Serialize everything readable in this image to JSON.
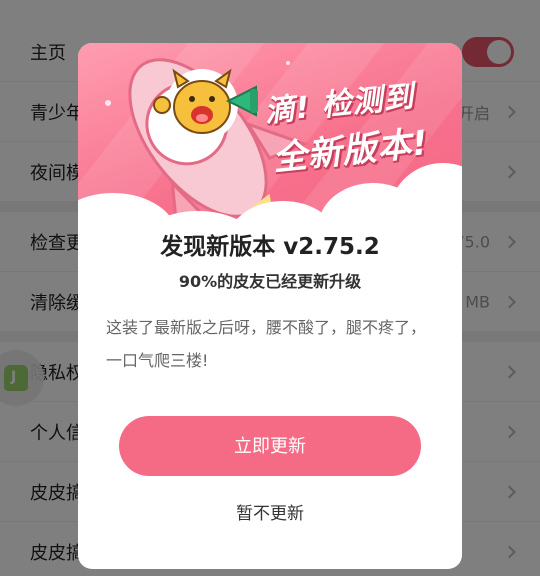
{
  "settings": {
    "rows": [
      {
        "label": "主页"
      },
      {
        "label": "青少年",
        "value": "开启"
      },
      {
        "label": "夜间模"
      },
      {
        "label": "检查更",
        "value": "75.0"
      },
      {
        "label": "清除缓",
        "value": "MB"
      },
      {
        "label": "隐私权"
      },
      {
        "label": "个人信"
      },
      {
        "label": "皮皮搞"
      },
      {
        "label": "皮皮搞"
      }
    ]
  },
  "dialog": {
    "headline_line1": "滴! 检测到",
    "headline_line2": "全新版本!",
    "title": "发现新版本 v2.75.2",
    "subtitle": "90%的皮友已经更新升级",
    "description": "这装了最新版之后呀，腰不酸了，腿不疼了，一口气爬三楼!",
    "update_now": "立即更新",
    "not_now": "暂不更新"
  },
  "colors": {
    "accent": "#f56a85",
    "banner_pink": "#f7708c",
    "toggle_on": "#e8546b"
  }
}
